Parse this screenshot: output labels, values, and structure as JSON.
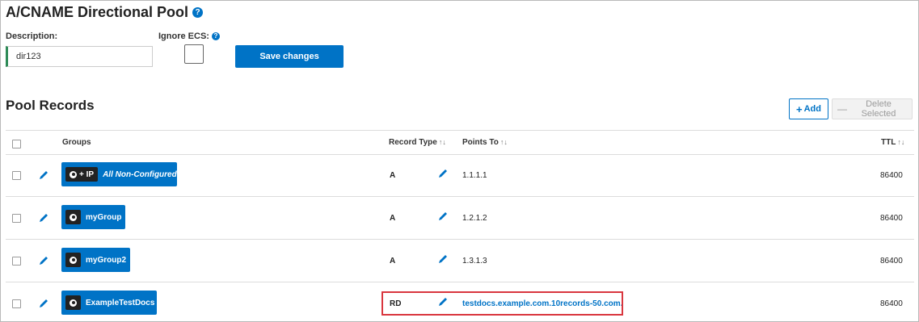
{
  "header": {
    "title": "A/CNAME Directional Pool"
  },
  "form": {
    "description_label": "Description:",
    "description_value": "dir123",
    "ignore_ecs_label": "Ignore ECS:",
    "ignore_ecs_checked": false,
    "save_label": "Save changes"
  },
  "pool_records": {
    "title": "Pool Records",
    "add_label": "Add",
    "delete_label": "Delete Selected",
    "columns": {
      "groups": "Groups",
      "record_type": "Record Type",
      "points_to": "Points To",
      "ttl": "TTL"
    },
    "rows": [
      {
        "badge_text": "+ IP",
        "group": "All Non-Configured",
        "record_type": "A",
        "points_to": "1.1.1.1",
        "ttl": "86400"
      },
      {
        "badge_text": "",
        "group": "myGroup",
        "record_type": "A",
        "points_to": "1.2.1.2",
        "ttl": "86400"
      },
      {
        "badge_text": "",
        "group": "myGroup2",
        "record_type": "A",
        "points_to": "1.3.1.3",
        "ttl": "86400"
      },
      {
        "badge_text": "",
        "group": "ExampleTestDocs",
        "record_type": "RD",
        "points_to": "testdocs.example.com.10records-50.com.",
        "ttl": "86400"
      }
    ]
  },
  "icons": {
    "help": "question-circle-icon",
    "edit": "pencil-icon",
    "globe": "globe-icon",
    "sort": "sort-arrows-icon"
  },
  "colors": {
    "accent": "#0073c6",
    "highlight": "#d9363e",
    "description_border": "#2e8b57"
  }
}
